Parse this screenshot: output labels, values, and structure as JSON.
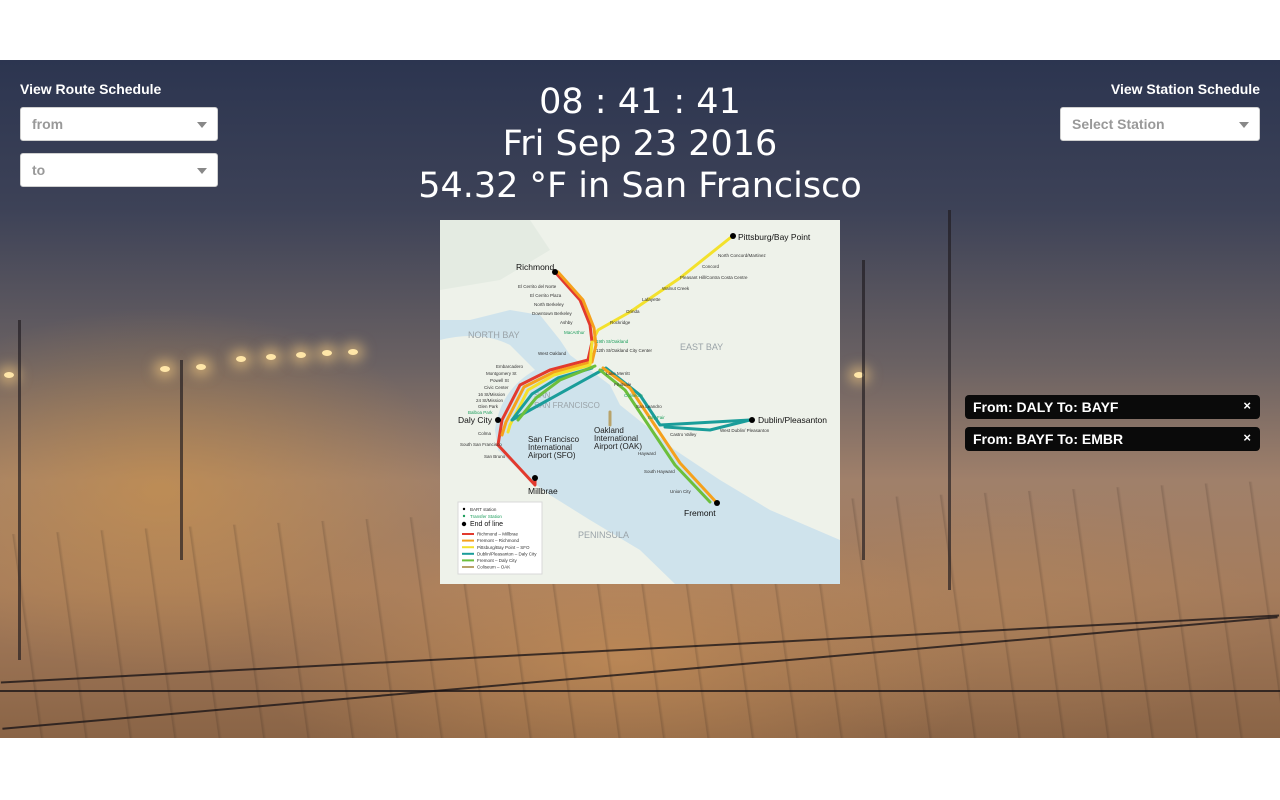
{
  "route_panel": {
    "title": "View Route Schedule",
    "from": {
      "placeholder": "from",
      "icon": "chevron-down-icon"
    },
    "to": {
      "placeholder": "to",
      "icon": "chevron-down-icon"
    }
  },
  "station_panel": {
    "title": "View Station Schedule",
    "select": {
      "placeholder": "Select Station",
      "icon": "chevron-down-icon"
    }
  },
  "header": {
    "clock": "08 : 41 : 41",
    "date": "Fri Sep 23 2016",
    "weather": "54.32 °F in San Francisco"
  },
  "map": {
    "regions": [
      "NORTH BAY",
      "EAST BAY",
      "SAN FRANCISCO",
      "PENINSULA"
    ],
    "terminals": {
      "pittsburg": "Pittsburg/Bay Point",
      "richmond": "Richmond",
      "daly_city": "Daly City",
      "millbrae": "Millbrae",
      "dublin": "Dublin/Pleasanton",
      "fremont": "Fremont"
    },
    "airports": {
      "sfo": [
        "San Francisco",
        "International",
        "Airport (SFO)"
      ],
      "oak": [
        "Oakland",
        "International",
        "Airport (OAK)"
      ]
    },
    "stations": {
      "north_concord": "North Concord/Martinez",
      "concord": "Concord",
      "pleasant_hill": "Pleasant Hill/Contra Costa Centre",
      "walnut_creek": "Walnut Creek",
      "lafayette": "Lafayette",
      "orinda": "Orinda",
      "rockridge": "Rockridge",
      "el_cerrito_del_norte": "El Cerrito del Norte",
      "el_cerrito_plaza": "El Cerrito Plaza",
      "north_berkeley": "North Berkeley",
      "downtown_berkeley": "Downtown Berkeley",
      "ashby": "Ashby",
      "macarthur": "MacArthur",
      "19th": "19th St/Oakland",
      "12th": "12th St/Oakland City Center",
      "west_oakland": "West Oakland",
      "embarcadero": "Embarcadero",
      "montgomery": "Montgomery St",
      "powell": "Powell St",
      "civic": "Civic Center",
      "16th": "16 St/Mission",
      "24th": "24 St/Mission",
      "glen_park": "Glen Park",
      "balboa": "Balboa Park",
      "colma": "Colma",
      "ssf": "South San Francisco",
      "san_bruno": "San Bruno",
      "lake_merritt": "Lake Merritt",
      "fruitvale": "Fruitvale",
      "coliseum": "Coliseum",
      "san_leandro": "San Leandro",
      "bay_fair": "Bay Fair",
      "castro_valley": "Castro Valley",
      "west_dublin": "West Dublin/ Pleasanton",
      "hayward": "Hayward",
      "south_hayward": "South Hayward",
      "union_city": "Union City"
    },
    "legend": {
      "bart_station": "BART station",
      "transfer_station": "Transfer Station",
      "end_of_line": "End of line",
      "lines": [
        {
          "label": "Richmond – Millbrae",
          "color": "#e23a2e"
        },
        {
          "label": "Fremont – Richmond",
          "color": "#f5a11c"
        },
        {
          "label": "Pittsburg/Bay Point – SFO",
          "color": "#f3e12c"
        },
        {
          "label": "Dublin/Pleasanton – Daly City",
          "color": "#1a9d9a"
        },
        {
          "label": "Fremont – Daly City",
          "color": "#6cbf3c"
        },
        {
          "label": "Coliseum – OAK",
          "color": "#b8a36a"
        }
      ]
    }
  },
  "trips": [
    {
      "label": "From: DALY To: BAYF",
      "close": "×"
    },
    {
      "label": "From: BAYF To: EMBR",
      "close": "×"
    }
  ]
}
